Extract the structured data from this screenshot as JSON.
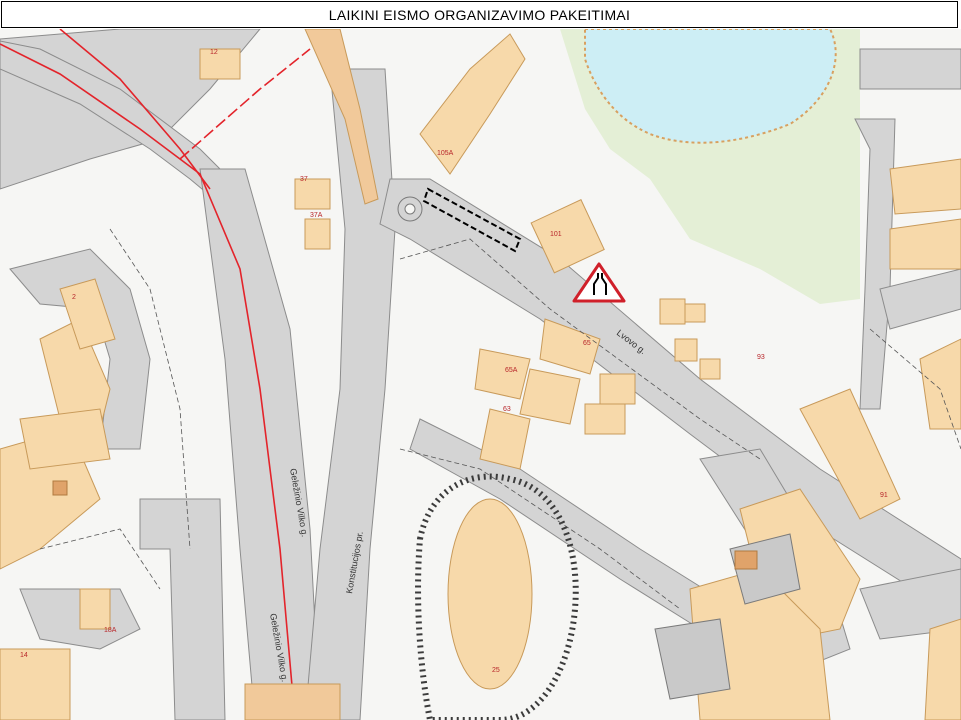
{
  "title": "LAIKINI  EISMO ORGANIZAVIMO  PAKEITIMAI",
  "streets": {
    "street_a": "Geležinio Vilko g.",
    "street_b": "Geležinio Vilko g.",
    "street_c": "Konstitucijos pr.",
    "street_d": "Lvovo g."
  },
  "building_labels": {
    "b105a": "105A",
    "b101": "101",
    "b2": "2",
    "b65a": "65A",
    "b65": "65",
    "b63": "63",
    "b93": "93",
    "b91": "91",
    "b25": "25",
    "b18a": "18A",
    "b14": "14",
    "b37": "37",
    "b37a": "37A",
    "b12": "12"
  },
  "colors": {
    "road": "#d4d4d4",
    "road_edge": "#8c8c8c",
    "building": "#f7d9aa",
    "building_edge": "#c89a5a",
    "green": "#e4efd6",
    "water": "#cdeef5",
    "rail": "#e3242b",
    "label": "#b8262a",
    "warning_sign": "#d0202a"
  },
  "icons": [
    "road-narrows-warning-sign-icon"
  ]
}
